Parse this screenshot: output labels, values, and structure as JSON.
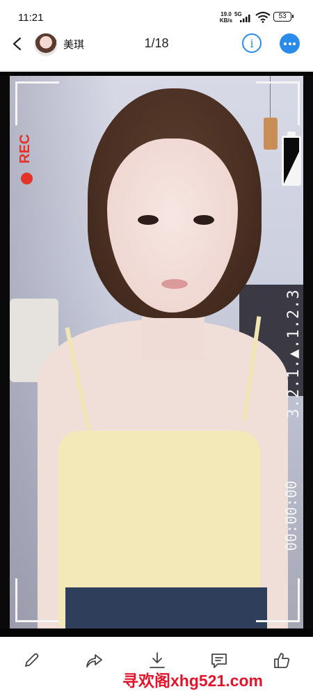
{
  "status_bar": {
    "time": "11:21",
    "speed_value": "19.0",
    "speed_unit": "KB/s",
    "network": "5G",
    "battery": "53"
  },
  "header": {
    "username": "美琪",
    "counter": "1/18",
    "info_glyph": "i",
    "accent_color": "#2a8bea"
  },
  "photo_overlay": {
    "rec_label": "REC",
    "ruler_text": "3.2.1.▲.1.2.3",
    "timecode": "00:00:00"
  },
  "bottom_bar": {
    "icons": [
      "edit-icon",
      "share-icon",
      "download-icon",
      "comment-icon",
      "like-icon"
    ],
    "watermark": "寻欢阁xhg521.com",
    "watermark_color": "#e2142b"
  }
}
